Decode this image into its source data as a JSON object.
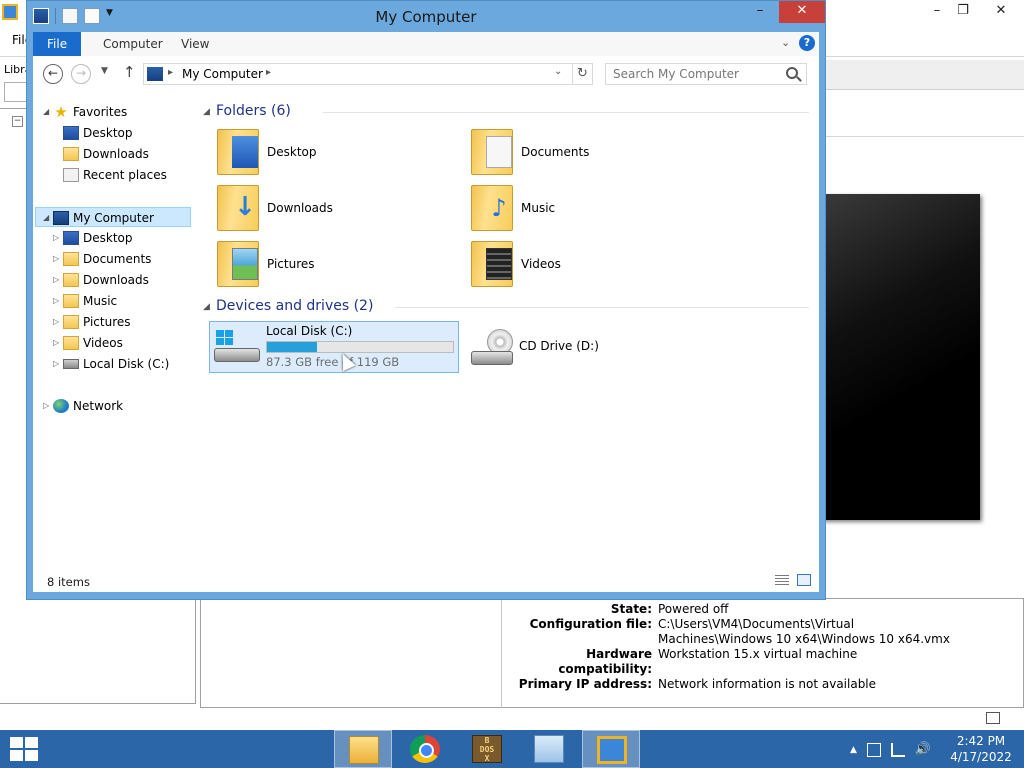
{
  "background_app": {
    "menu": {
      "file_label": "File"
    },
    "library_label": "Library",
    "tree_toggle": "−",
    "window_controls": {
      "minimize": "–",
      "maximize": "❐",
      "close": "✕"
    },
    "details": [
      {
        "key": "State:",
        "value": "Powered off"
      },
      {
        "key": "Configuration file:",
        "value": "C:\\Users\\VM4\\Documents\\Virtual Machines\\Windows 10 x64\\Windows 10 x64.vmx"
      },
      {
        "key": "Hardware compatibility:",
        "value": "Workstation 15.x virtual machine"
      },
      {
        "key": "Primary IP address:",
        "value": "Network information is not available"
      }
    ]
  },
  "explorer": {
    "title": "My Computer",
    "window_controls": {
      "minimize": "–",
      "maximize": "□",
      "close": "✕"
    },
    "ribbon_tabs": [
      "File",
      "Computer",
      "View"
    ],
    "address": {
      "location": "My Computer"
    },
    "search": {
      "placeholder": "Search My Computer"
    },
    "nav": {
      "favorites": {
        "label": "Favorites",
        "items": [
          "Desktop",
          "Downloads",
          "Recent places"
        ]
      },
      "computer": {
        "label": "My Computer",
        "items": [
          "Desktop",
          "Documents",
          "Downloads",
          "Music",
          "Pictures",
          "Videos",
          "Local Disk (C:)"
        ]
      },
      "network": {
        "label": "Network"
      }
    },
    "folders_group": {
      "title": "Folders (6)",
      "items": [
        "Desktop",
        "Documents",
        "Downloads",
        "Music",
        "Pictures",
        "Videos"
      ]
    },
    "drives_group": {
      "title": "Devices and drives (2)",
      "local_disk": {
        "name": "Local Disk (C:)",
        "free_text": "87.3 GB free of 119 GB",
        "used_fraction": 0.27
      },
      "cd_drive": {
        "name": "CD Drive (D:)"
      }
    },
    "status": {
      "items_text": "8 items"
    }
  },
  "taskbar": {
    "clock_time": "2:42 PM",
    "clock_date": "4/17/2022",
    "apps": [
      "file-explorer",
      "google-chrome",
      "dosbox",
      "performance-monitor",
      "vmware-workstation"
    ],
    "dosbox_glyphs": "B\nDOS\nX"
  },
  "colors": {
    "window_frame": "#6aa8dd",
    "selection": "#cce8ff",
    "file_tab": "#1a6ccc",
    "close_button": "#c7413a",
    "taskbar": "#2a66a8",
    "drive_bar": "#26a0da"
  }
}
